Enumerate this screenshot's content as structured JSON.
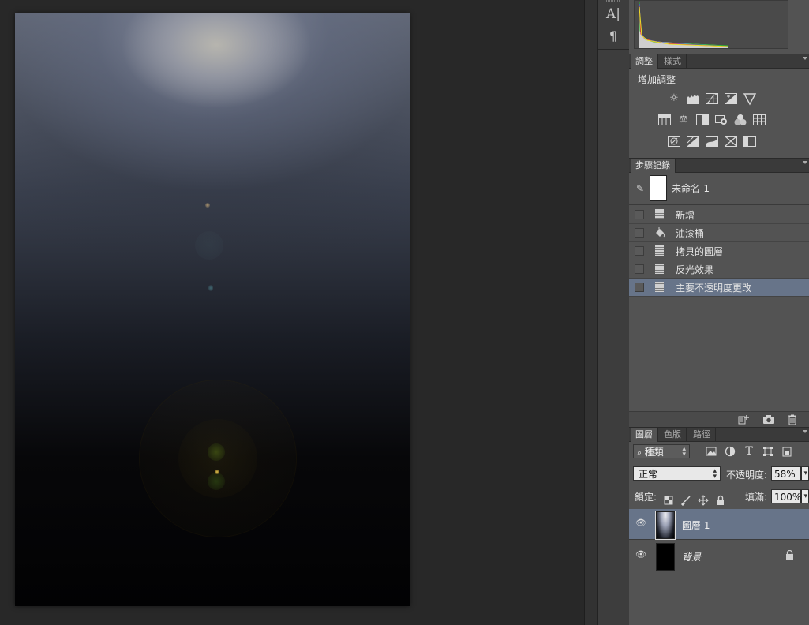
{
  "toolstrip": {
    "character_glyph": "A|",
    "paragraph_glyph": "¶"
  },
  "adjustments_panel": {
    "tabs": [
      "調整",
      "樣式"
    ],
    "title": "增加調整",
    "icons_row1": [
      "brightness-contrast-icon",
      "levels-icon",
      "curves-icon",
      "exposure-icon",
      "vibrance-icon"
    ],
    "icons_row2": [
      "hue-saturation-icon",
      "color-balance-icon",
      "black-white-icon",
      "photo-filter-icon",
      "channel-mixer-icon",
      "color-lookup-icon"
    ],
    "icons_row3": [
      "invert-icon",
      "posterize-icon",
      "threshold-icon",
      "selective-color-icon",
      "gradient-map-icon"
    ]
  },
  "history_panel": {
    "tab": "步驟記錄",
    "snapshot_label": "未命名-1",
    "items": [
      {
        "label": "新增",
        "icon": "document-icon"
      },
      {
        "label": "油漆桶",
        "icon": "paint-bucket-icon"
      },
      {
        "label": "拷貝的圖層",
        "icon": "document-icon"
      },
      {
        "label": "反光效果",
        "icon": "document-icon"
      },
      {
        "label": "主要不透明度更改",
        "icon": "document-icon",
        "selected": true
      }
    ]
  },
  "layers_panel": {
    "tabs": [
      "圖層",
      "色版",
      "路徑"
    ],
    "filter_kind": "種類",
    "blend_mode": "正常",
    "opacity_label": "不透明度:",
    "opacity_value": "58%",
    "lock_label": "鎖定:",
    "fill_label": "填滿:",
    "fill_value": "100%",
    "layers": [
      {
        "name": "圖層 1",
        "visible": true,
        "selected": true
      },
      {
        "name": "背景",
        "visible": true,
        "locked": true,
        "italic": true
      }
    ]
  },
  "colors": {
    "selection": "#677489",
    "panel_bg": "#535353",
    "workspace_bg": "#282828"
  }
}
